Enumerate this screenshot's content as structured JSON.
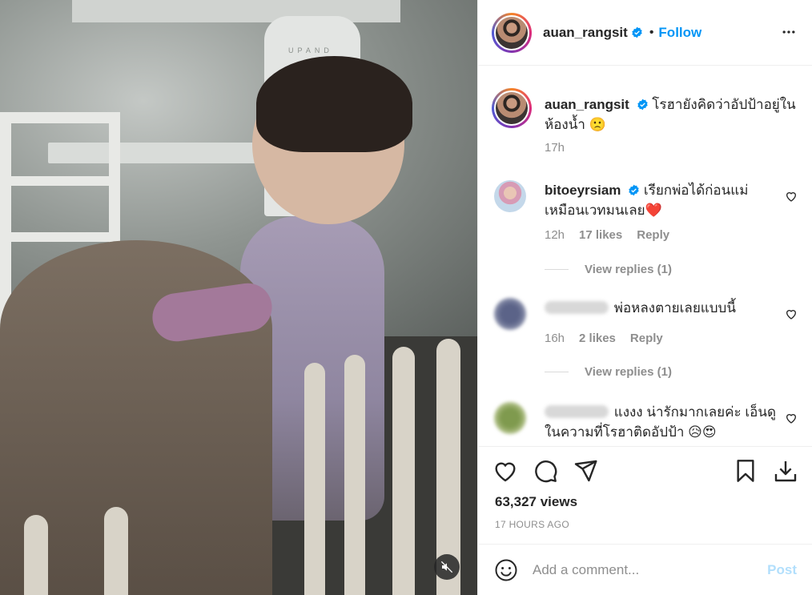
{
  "post": {
    "username": "auan_rangsit",
    "follow_label": "Follow",
    "dot": "•",
    "caption": "โรฮายังคิดว่าอัปป้าอยู่ในห้องน้ำ 🙁",
    "caption_time": "17h",
    "media_brand": "UPAND"
  },
  "comments": [
    {
      "username": "bitoeyrsiam",
      "verified": true,
      "text": "เรียกพ่อได้ก่อนแม่เหมือนเวทมนเลย❤️",
      "time": "12h",
      "likes": "17 likes",
      "reply_label": "Reply",
      "view_replies": "View replies (1)"
    },
    {
      "username": "",
      "verified": false,
      "text": "พ่อหลงตายเลยแบบนี้",
      "time": "16h",
      "likes": "2 likes",
      "reply_label": "Reply",
      "view_replies": "View replies (1)"
    },
    {
      "username": "",
      "verified": false,
      "text": "แงงง น่ารักมากเลยค่ะ เอ็นดูในความที่โรฮาติดอัปป้า 😥😍",
      "time": "",
      "likes": "",
      "reply_label": "",
      "view_replies": ""
    }
  ],
  "stats": {
    "views": "63,327 views",
    "posted_ago": "17 HOURS AGO"
  },
  "add_comment": {
    "placeholder": "Add a comment...",
    "post_label": "Post"
  },
  "colors": {
    "accent": "#0095f6",
    "post_disabled": "#b2dffc",
    "secondary_text": "#8e8e8e"
  },
  "icons": [
    "mute-icon",
    "verified-icon",
    "more-icon",
    "heart-icon",
    "comment-icon",
    "share-icon",
    "save-icon",
    "download-icon",
    "emoji-icon"
  ]
}
